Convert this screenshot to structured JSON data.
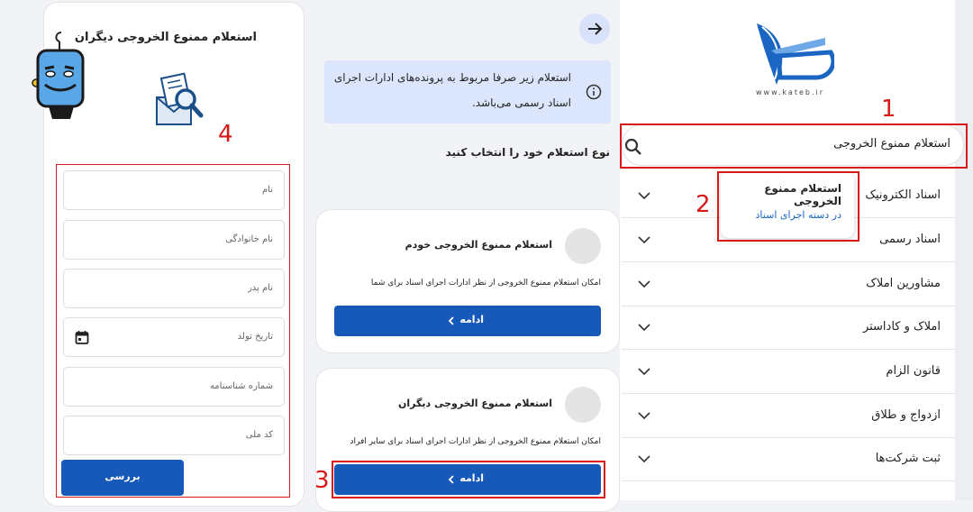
{
  "brand": {
    "logo_caption": "www.kateb.ir",
    "accent": "#1659b8",
    "annotation_color": "#d61a1a"
  },
  "right": {
    "search_value": "استعلام ممنوع الخروجی",
    "dropdown": {
      "title": "استعلام ممنوع الخروجی",
      "subtitle": "در دسته اجرای اسناد"
    },
    "menu": [
      {
        "label": "اسناد الکترونیک"
      },
      {
        "label": "اسناد رسمی"
      },
      {
        "label": "مشاورین املاک"
      },
      {
        "label": "املاک و کاداستر"
      },
      {
        "label": "قانون الزام"
      },
      {
        "label": "ازدواج و طلاق"
      },
      {
        "label": "ثبت شرکت‌ها"
      }
    ]
  },
  "middle": {
    "info_line1": "استعلام زیر صرفا مربوط به پرونده‌های ادارات اجرای",
    "info_line2": "اسناد رسمی می‌باشد.",
    "choose_label": "نوع استعلام خود را انتخاب کنید",
    "cards": [
      {
        "title": "استعلام ممنوع الخروجی خودم",
        "desc": "امکان استعلام ممنوع الخروجی از نظر ادارات اجرای اسناد برای شما",
        "button": "ادامه"
      },
      {
        "title": "استعلام ممنوع الخروجی دیگران",
        "desc": "امکان استعلام ممنوع الخروجی از نظر ادارات اجرای اسناد برای سایر افراد",
        "button": "ادامه"
      }
    ]
  },
  "left": {
    "title": "استعلام ممنوع الخروجی دیگران",
    "fields": [
      {
        "placeholder": "نام"
      },
      {
        "placeholder": "نام خانوادگی"
      },
      {
        "placeholder": "نام پدر"
      },
      {
        "placeholder": "تاریخ تولد"
      },
      {
        "placeholder": "شماره شناسنامه"
      },
      {
        "placeholder": "کد ملی"
      }
    ],
    "submit": "بررسی"
  },
  "annotations": {
    "n1": "1",
    "n2": "2",
    "n3": "3",
    "n4": "4"
  }
}
